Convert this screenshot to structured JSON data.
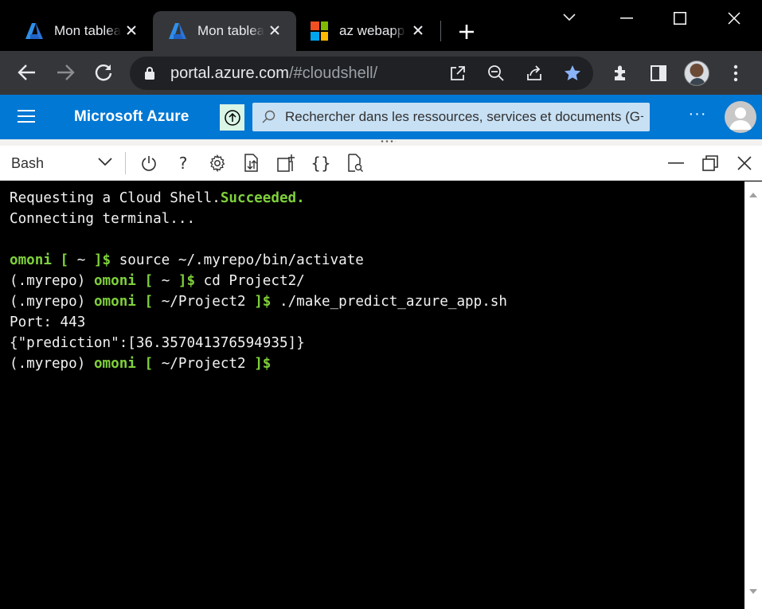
{
  "browser": {
    "tabs": [
      {
        "title": "Mon tableau de bord - Microsoft Azure",
        "favicon": "azure-logo-icon",
        "active": false
      },
      {
        "title": "Mon tableau de bord - Microsoft Azure",
        "favicon": "azure-logo-icon",
        "active": true
      },
      {
        "title": "az webapp",
        "favicon": "microsoft-logo-icon",
        "active": false
      }
    ],
    "url_host": "portal.azure.com",
    "url_path": "/#cloudshell/"
  },
  "azure": {
    "brand": "Microsoft Azure",
    "search_placeholder": "Rechercher dans les ressources, services et documents (G+/)",
    "more": "···"
  },
  "cloudshell": {
    "shell_type": "Bash",
    "help_label": "?",
    "braces_label": "{}"
  },
  "terminal": {
    "lines": [
      [
        {
          "t": "Requesting a Cloud Shell.",
          "c": "w"
        },
        {
          "t": "Succeeded.",
          "c": "g"
        }
      ],
      [
        {
          "t": "Connecting terminal...",
          "c": "w"
        }
      ],
      [],
      [
        {
          "t": "omoni",
          "c": "g"
        },
        {
          "t": " [ ",
          "c": "g"
        },
        {
          "t": "~",
          "c": "w"
        },
        {
          "t": " ]$",
          "c": "g"
        },
        {
          "t": " source ~/.myrepo/bin/activate",
          "c": "w"
        }
      ],
      [
        {
          "t": "(.myrepo) ",
          "c": "w"
        },
        {
          "t": "omoni",
          "c": "g"
        },
        {
          "t": " [ ",
          "c": "g"
        },
        {
          "t": "~",
          "c": "w"
        },
        {
          "t": " ]$",
          "c": "g"
        },
        {
          "t": " cd Project2/",
          "c": "w"
        }
      ],
      [
        {
          "t": "(.myrepo) ",
          "c": "w"
        },
        {
          "t": "omoni",
          "c": "g"
        },
        {
          "t": " [ ",
          "c": "g"
        },
        {
          "t": "~/Project2",
          "c": "w"
        },
        {
          "t": " ]$",
          "c": "g"
        },
        {
          "t": " ./make_predict_azure_app.sh",
          "c": "w"
        }
      ],
      [
        {
          "t": "Port: 443",
          "c": "w"
        }
      ],
      [
        {
          "t": "{\"prediction\":[36.357041376594935]}",
          "c": "w"
        }
      ],
      [
        {
          "t": "(.myrepo) ",
          "c": "w"
        },
        {
          "t": "omoni",
          "c": "g"
        },
        {
          "t": " [ ",
          "c": "g"
        },
        {
          "t": "~/Project2",
          "c": "w"
        },
        {
          "t": " ]$",
          "c": "g"
        }
      ]
    ]
  },
  "colors": {
    "azure_blue": "#0078d4",
    "terminal_green": "#7fd13b",
    "tab_active": "#35363a"
  }
}
